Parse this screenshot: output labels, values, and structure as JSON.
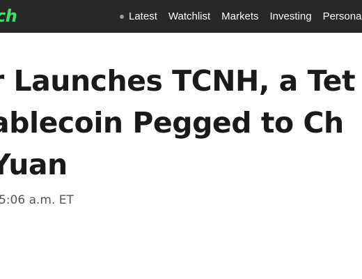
{
  "header": {
    "logo_text": "ch",
    "nav_items": [
      "Latest",
      "Watchlist",
      "Markets",
      "Investing",
      "Personal"
    ],
    "background_color": "#282828",
    "logo_color": "#3ee06a"
  },
  "article": {
    "headline_lines": [
      "r Launches TCNH, a Tet",
      "ablecoin Pegged to Ch",
      "Yuan"
    ],
    "timestamp": "5:06 a.m. ET"
  }
}
